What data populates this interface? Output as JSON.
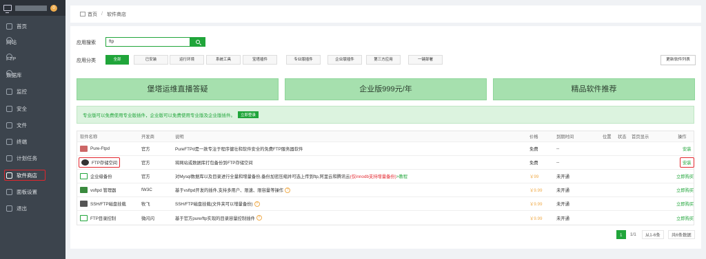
{
  "sidebar": {
    "badge": "0",
    "items": [
      "首页",
      "网站",
      "FTP",
      "数据库",
      "监控",
      "安全",
      "文件",
      "终端",
      "计划任务",
      "软件商店",
      "面板设置",
      "退出"
    ]
  },
  "breadcrumb": {
    "home": "首页",
    "sep": "/",
    "current": "软件商店"
  },
  "search": {
    "label": "应用搜索",
    "value": "ftp"
  },
  "categories": {
    "label": "应用分类",
    "items": [
      "全部",
      "已安装",
      "运行环境",
      "系统工具",
      "宝塔插件",
      "专业版插件",
      "企业版插件",
      "第三方应用",
      "一键部署"
    ]
  },
  "update_btn": "更新软件列表",
  "banners": [
    "堡塔运维直播答疑",
    "企业版999元/年",
    "精品软件推荐"
  ],
  "notice": {
    "text": "专业版可以免费使用专业版插件，企业版可以免费使用专业版及企业版插件。",
    "login": "立即登录"
  },
  "table": {
    "headers": [
      "软件名称",
      "开发商",
      "说明",
      "价格",
      "到期时间",
      "位置",
      "状态",
      "首页显示",
      "操作"
    ],
    "rows": [
      {
        "name": "Pure-Ftpd",
        "dev": "官方",
        "desc": "PureFTPd是一款专注于程序健壮和软件安全的免费FTP服务器软件",
        "price": "免费",
        "expire": "--",
        "op": "安装"
      },
      {
        "name": "FTP存储空间",
        "dev": "官方",
        "desc": "将网站或数据库打包备份到FTP存储空间",
        "price": "免费",
        "expire": "--",
        "op": "安装"
      },
      {
        "name": "企业级备份",
        "dev": "官方",
        "desc": "对Mysql数据库以及目录进行全量和增量备份,备份加密压缩并可选上传到ftp,阿里云和腾讯云",
        "desc_red": "(仅innodb支持增量备份)",
        "desc_link": ">教程",
        "price": "￥99",
        "expire": "未开通",
        "op": "立即购买"
      },
      {
        "name": "vsftpd 管理器",
        "dev": "fW3C",
        "desc": "基于vsftpd开发的插件,支持多用户、限速、限容量等操作",
        "price": "￥9.99",
        "expire": "未开通",
        "op": "立即购买"
      },
      {
        "name": "SSH/FTP磁盘挂载",
        "dev": "牧飞",
        "desc": "SSH/FTP磁盘挂载(文件夹可以增量备份)",
        "price": "￥9.99",
        "expire": "未开通",
        "op": "立即购买"
      },
      {
        "name": "FTP目录控制",
        "dev": "微闪闪",
        "desc": "基于官方pure/ftp实现的目录容量控制插件",
        "price": "￥9.99",
        "expire": "未开通",
        "op": "立即购买"
      }
    ]
  },
  "pagination": {
    "current": "1",
    "pages": "1/1",
    "range": "从1-6条",
    "total": "共6条数据"
  },
  "colors": {
    "accent": "#20a53a",
    "highlight": "#e3262d",
    "price": "#f0ad4e",
    "sidebar": "#3c444d"
  }
}
